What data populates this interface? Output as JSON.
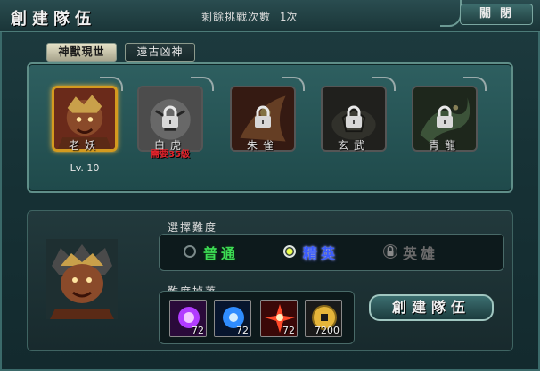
{
  "window": {
    "title": "創建隊伍",
    "remaining_label": "剩餘挑戰次數",
    "remaining_count": "1次",
    "close_label": "關閉"
  },
  "tabs": [
    {
      "label": "神獸現世",
      "active": true
    },
    {
      "label": "遠古凶神",
      "active": false
    }
  ],
  "bosses": [
    {
      "name": "老妖",
      "level": "Lv. 10",
      "locked": false,
      "selected": true,
      "requirement": ""
    },
    {
      "name": "白虎",
      "locked": true,
      "selected": false,
      "requirement": "需要35級"
    },
    {
      "name": "朱雀",
      "locked": true,
      "selected": false,
      "requirement": ""
    },
    {
      "name": "玄武",
      "locked": true,
      "selected": false,
      "requirement": ""
    },
    {
      "name": "青龍",
      "locked": true,
      "selected": false,
      "requirement": ""
    }
  ],
  "difficulty": {
    "label": "選擇難度",
    "options": [
      {
        "label": "普通",
        "selected": false,
        "locked": false,
        "color": "#3ddc55"
      },
      {
        "label": "精英",
        "selected": true,
        "locked": false,
        "color": "#3b5cff"
      },
      {
        "label": "英雄",
        "selected": false,
        "locked": true,
        "color": "#6a6a6a"
      }
    ]
  },
  "drops": {
    "label": "難度掉落",
    "items": [
      {
        "icon": "purple-orb-icon",
        "qty": "72",
        "color": "#b23cff"
      },
      {
        "icon": "blue-orb-icon",
        "qty": "72",
        "color": "#2f8cff"
      },
      {
        "icon": "red-star-icon",
        "qty": "72",
        "color": "#ff4a2a"
      },
      {
        "icon": "gold-coin-icon",
        "qty": "7200",
        "color": "#e5b53a"
      }
    ]
  },
  "create_button": "創建隊伍"
}
